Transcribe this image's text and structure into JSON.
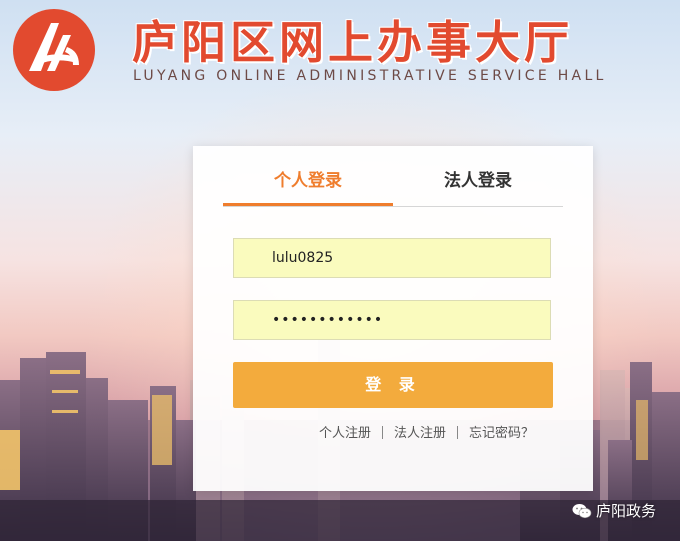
{
  "header": {
    "title_cn": "庐阳区网上办事大厅",
    "title_en": "LUYANG ONLINE ADMINISTRATIVE SERVICE HALL"
  },
  "colors": {
    "brand_red": "#e24a2f",
    "active_tab": "#ef7d2d",
    "login_button": "#f3ab3d",
    "input_bg": "#fafbbe"
  },
  "login": {
    "tabs": [
      {
        "label": "个人登录",
        "active": true
      },
      {
        "label": "法人登录",
        "active": false
      }
    ],
    "username_value": "lulu0825",
    "password_value": "••••••••••••",
    "submit_label": "登 录",
    "links": {
      "register_personal": "个人注册",
      "register_legal": "法人注册",
      "forgot_password": "忘记密码？"
    }
  },
  "watermark": {
    "text": "庐阳政务",
    "icon": "wechat-icon"
  }
}
